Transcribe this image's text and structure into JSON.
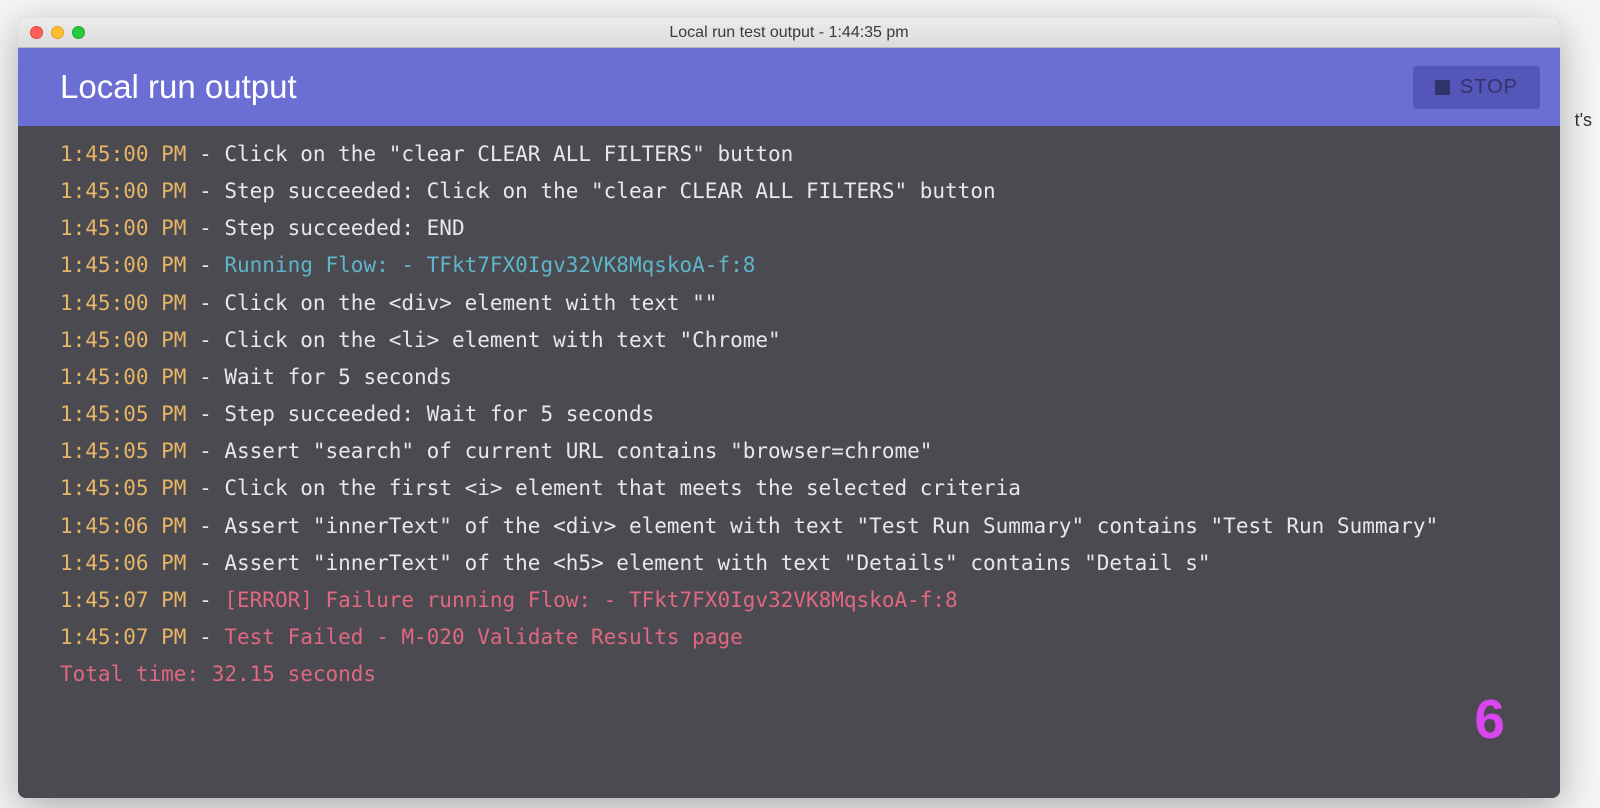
{
  "window": {
    "title": "Local run test output - 1:44:35 pm"
  },
  "header": {
    "title": "Local run output",
    "stop_label": "STOP"
  },
  "log": [
    {
      "ts": "1:45:00 PM",
      "kind": "normal",
      "msg": "Click on the \"clear CLEAR ALL FILTERS\" button"
    },
    {
      "ts": "1:45:00 PM",
      "kind": "normal",
      "msg": "Step succeeded: Click on the \"clear CLEAR ALL FILTERS\" button"
    },
    {
      "ts": "1:45:00 PM",
      "kind": "normal",
      "msg": "Step succeeded: END"
    },
    {
      "ts": "1:45:00 PM",
      "kind": "flow",
      "msg": "Running Flow: - TFkt7FX0Igv32VK8MqskoA-f:8"
    },
    {
      "ts": "1:45:00 PM",
      "kind": "normal",
      "msg": "Click on the <div> element with text \"\""
    },
    {
      "ts": "1:45:00 PM",
      "kind": "normal",
      "msg": "Click on the <li> element with text \"Chrome\""
    },
    {
      "ts": "1:45:00 PM",
      "kind": "normal",
      "msg": "Wait for 5 seconds"
    },
    {
      "ts": "1:45:05 PM",
      "kind": "normal",
      "msg": "Step succeeded: Wait for 5 seconds"
    },
    {
      "ts": "1:45:05 PM",
      "kind": "normal",
      "msg": "Assert \"search\" of current URL contains \"browser=chrome\""
    },
    {
      "ts": "1:45:05 PM",
      "kind": "normal",
      "msg": "Click on the first <i> element that meets the selected criteria"
    },
    {
      "ts": "1:45:06 PM",
      "kind": "normal",
      "msg": "Assert \"innerText\" of the <div> element with text \"Test Run Summary\" contains \"Test Run Summary\""
    },
    {
      "ts": "1:45:06 PM",
      "kind": "normal",
      "msg": "Assert \"innerText\" of the <h5> element with text \"Details\" contains \"Detail s\""
    },
    {
      "ts": "1:45:07 PM",
      "kind": "error",
      "msg": "[ERROR] Failure running Flow: - TFkt7FX0Igv32VK8MqskoA-f:8"
    },
    {
      "ts": "1:45:07 PM",
      "kind": "failed",
      "msg": "Test Failed - M-020 Validate Results page"
    }
  ],
  "total_time": "Total time: 32.15 seconds",
  "annotation": "6",
  "bg_hint": "t's"
}
